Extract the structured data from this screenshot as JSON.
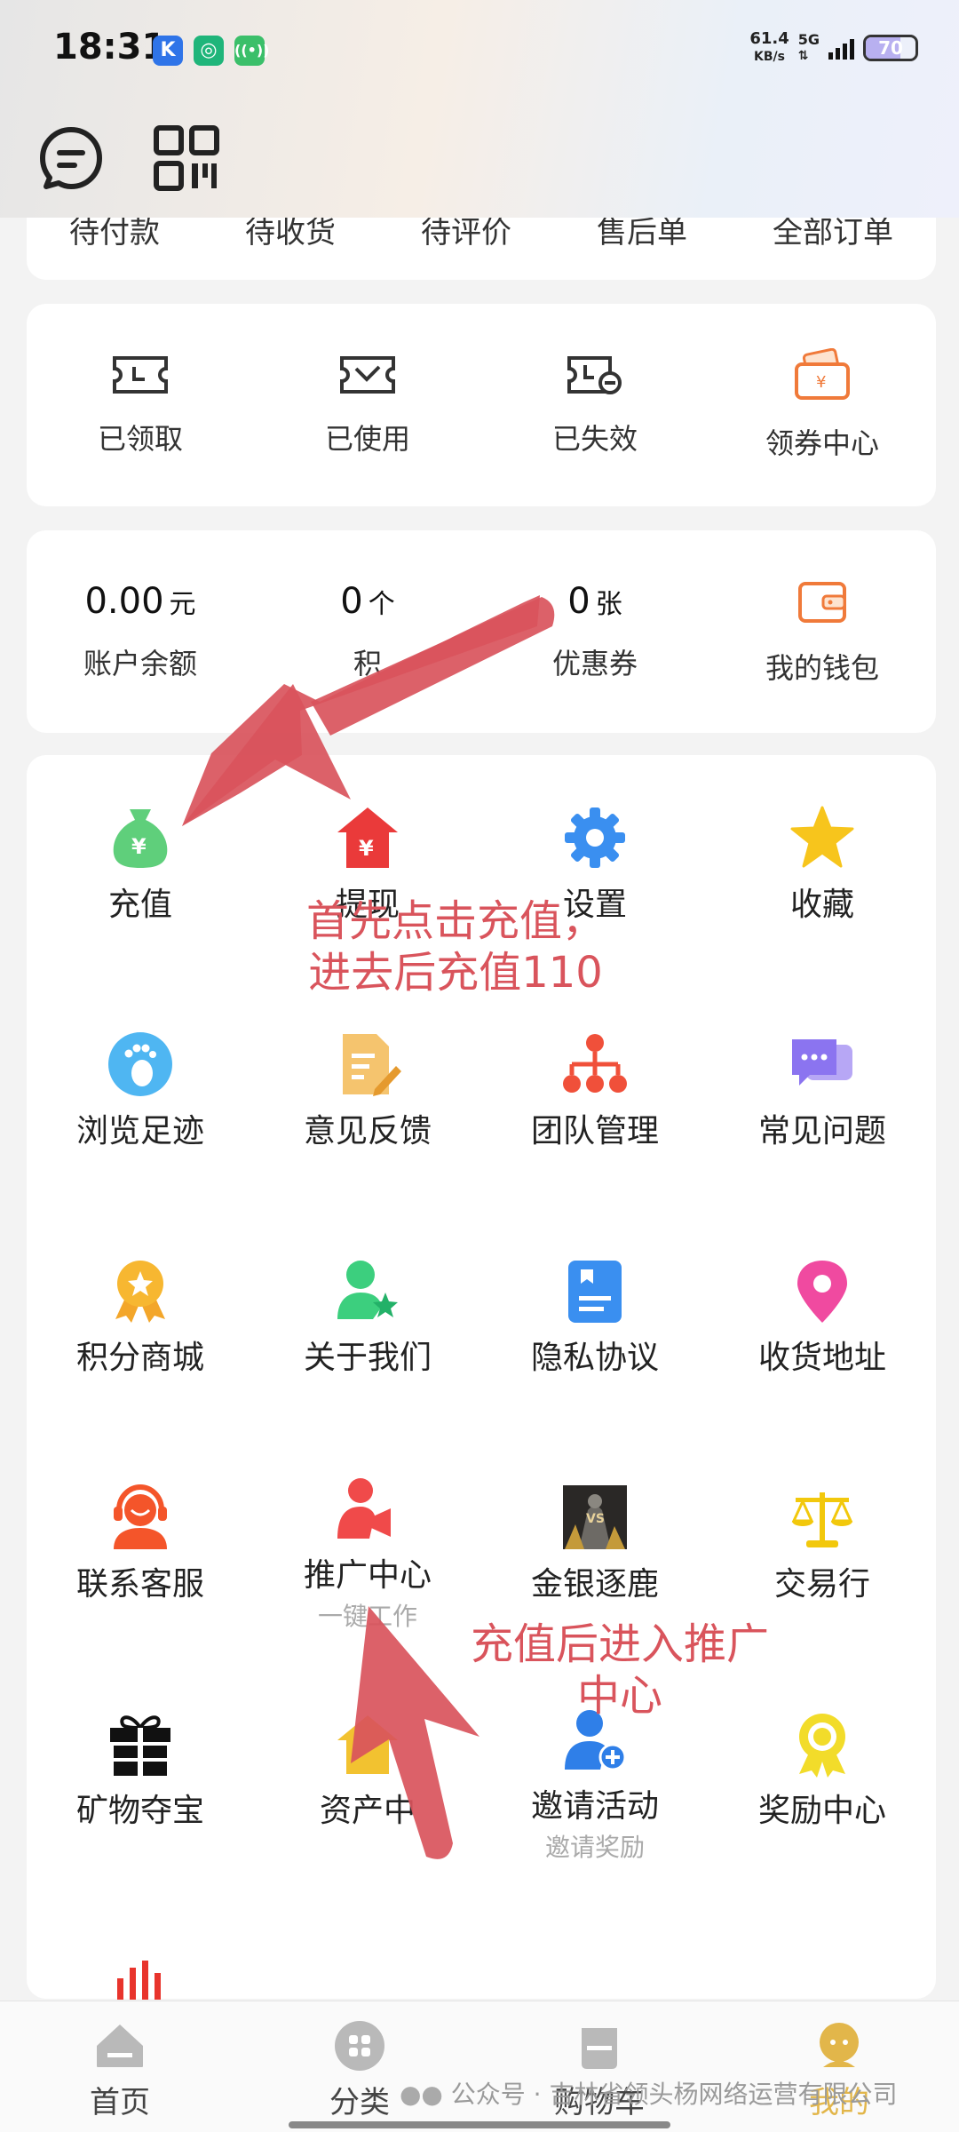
{
  "status": {
    "time": "18:31",
    "net_speed_value": "61.4",
    "net_speed_unit": "KB/s",
    "signal": "5G",
    "battery": "70",
    "battery_level": 0.7
  },
  "orders": {
    "items": [
      "待付款",
      "待收货",
      "待评价",
      "售后单",
      "全部订单"
    ]
  },
  "coupons": {
    "items": [
      {
        "label": "已领取",
        "icon": "ticket-icon"
      },
      {
        "label": "已使用",
        "icon": "ticket-used-icon"
      },
      {
        "label": "已失效",
        "icon": "ticket-expired-icon"
      },
      {
        "label": "领券中心",
        "icon": "coupon-center-icon"
      }
    ]
  },
  "assets": {
    "balance_value": "0.00",
    "balance_unit": "元",
    "balance_label": "账户余额",
    "points_value": "0",
    "points_unit": "个",
    "points_label": "积",
    "coupon_value": "0",
    "coupon_unit": "张",
    "coupon_label": "优惠券",
    "wallet_label": "我的钱包"
  },
  "features": {
    "recharge": "充值",
    "withdraw": "提现",
    "settings": "设置",
    "favorites": "收藏",
    "history": "浏览足迹",
    "feedback": "意见反馈",
    "team": "团队管理",
    "faq": "常见问题",
    "points_mall": "积分商城",
    "about": "关于我们",
    "privacy": "隐私协议",
    "address": "收货地址",
    "support": "联系客服",
    "promo": "推广中心",
    "promo_sub": "一键工作",
    "game": "金银逐鹿",
    "exchange": "交易行",
    "treasure": "矿物夺宝",
    "assets_center": "资产中",
    "invite": "邀请活动",
    "invite_sub": "邀请奖励",
    "rewards": "奖励中心"
  },
  "annotations": {
    "step1_line1": "首先点击充值，",
    "step1_line2": "进去后充值110",
    "step2_line1": "充值后进入推广",
    "step2_line2": "中心"
  },
  "nav": {
    "home": "首页",
    "category": "分类",
    "cart": "购物车",
    "mine": "我的"
  },
  "watermark": "公众号 · 吉林省领头杨网络运营有限公司",
  "colors": {
    "annotation": "#d9545c",
    "accent_orange": "#f07a3a",
    "active_tab": "#e2b64a"
  }
}
